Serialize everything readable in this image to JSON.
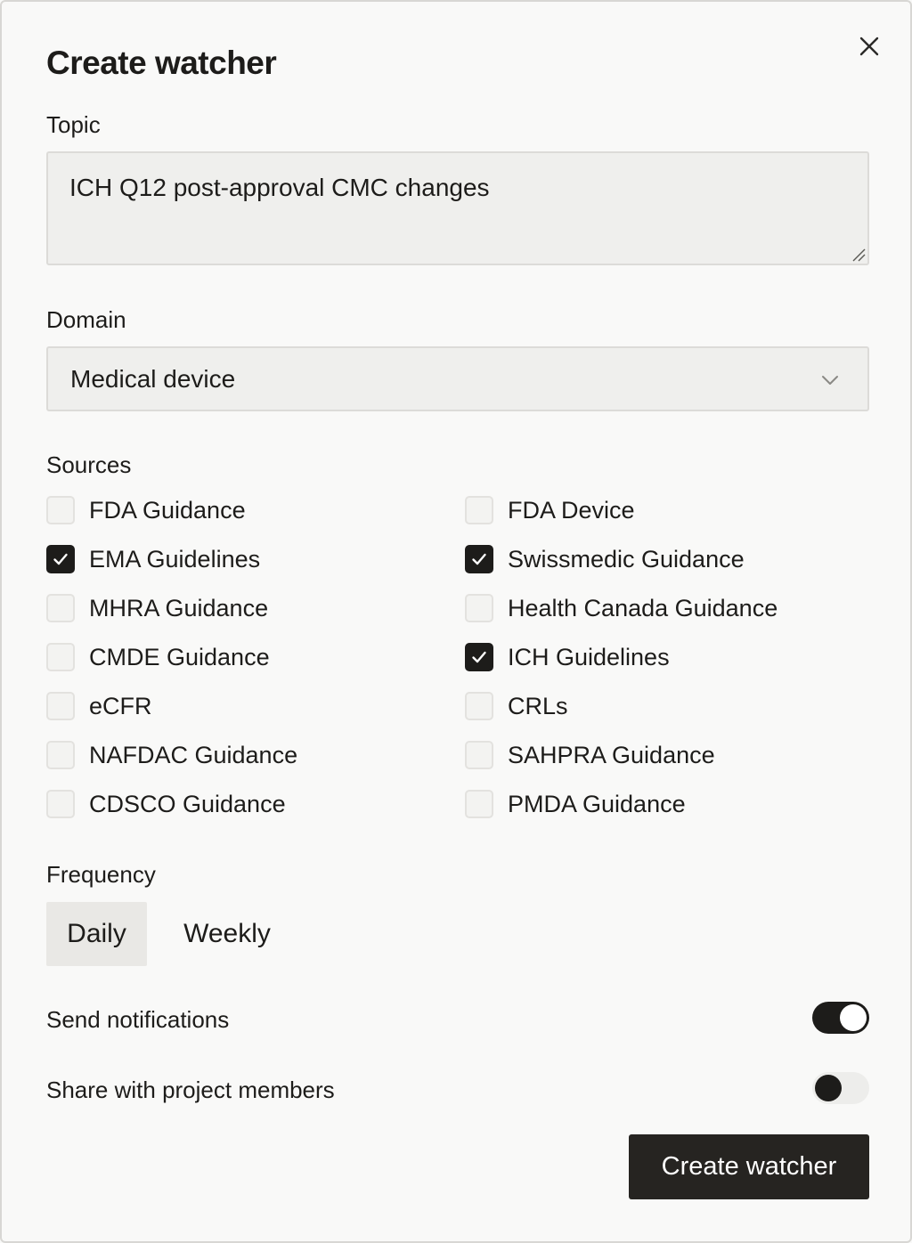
{
  "dialog": {
    "title": "Create watcher",
    "close_icon": "close-icon"
  },
  "topic": {
    "label": "Topic",
    "value": "ICH Q12 post-approval CMC changes"
  },
  "domain": {
    "label": "Domain",
    "selected": "Medical device",
    "icon": "chevron-down-icon"
  },
  "sources": {
    "label": "Sources",
    "left": [
      {
        "label": "FDA Guidance",
        "checked": false
      },
      {
        "label": "EMA Guidelines",
        "checked": true
      },
      {
        "label": "MHRA Guidance",
        "checked": false
      },
      {
        "label": "CMDE Guidance",
        "checked": false
      },
      {
        "label": "eCFR",
        "checked": false
      },
      {
        "label": "NAFDAC Guidance",
        "checked": false
      },
      {
        "label": "CDSCO Guidance",
        "checked": false
      }
    ],
    "right": [
      {
        "label": "FDA Device",
        "checked": false
      },
      {
        "label": "Swissmedic Guidance",
        "checked": true
      },
      {
        "label": "Health Canada Guidance",
        "checked": false
      },
      {
        "label": "ICH Guidelines",
        "checked": true
      },
      {
        "label": "CRLs",
        "checked": false
      },
      {
        "label": "SAHPRA Guidance",
        "checked": false
      },
      {
        "label": "PMDA Guidance",
        "checked": false
      }
    ]
  },
  "frequency": {
    "label": "Frequency",
    "options": [
      "Daily",
      "Weekly"
    ],
    "selected": "Daily"
  },
  "notifications": {
    "label": "Send notifications",
    "enabled": true
  },
  "share": {
    "label": "Share with project members",
    "enabled": false
  },
  "submit": {
    "label": "Create watcher"
  },
  "colors": {
    "background": "#f9f9f8",
    "text": "#1d1c1a",
    "primary_button": "#262421",
    "field_bg": "#efefed"
  }
}
